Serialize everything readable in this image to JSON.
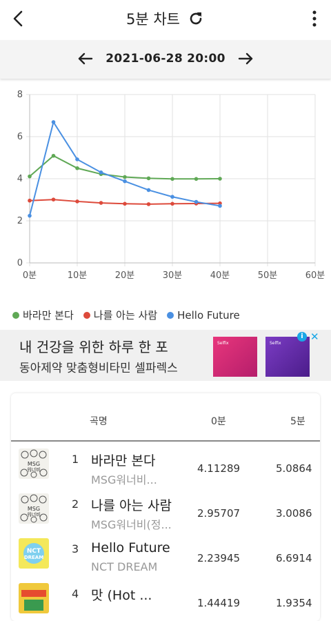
{
  "header": {
    "title": "5분 차트"
  },
  "date_nav": {
    "date": "2021-06-28 20:00"
  },
  "chart_data": {
    "type": "line",
    "x": [
      0,
      5,
      10,
      15,
      20,
      25,
      30,
      35,
      40
    ],
    "x_ticks": [
      "0분",
      "10분",
      "20분",
      "30분",
      "40분",
      "50분",
      "60분"
    ],
    "x_tick_values": [
      0,
      10,
      20,
      30,
      40,
      50,
      60
    ],
    "xlim": [
      0,
      60
    ],
    "ylim": [
      0,
      8
    ],
    "y_ticks": [
      0,
      2,
      4,
      6,
      8
    ],
    "grid": true,
    "legend_position": "bottom",
    "series": [
      {
        "name": "바라만 본다",
        "color": "#5fa855",
        "values": [
          4.11,
          5.09,
          4.5,
          4.22,
          4.08,
          4.02,
          3.99,
          3.99,
          4.0
        ]
      },
      {
        "name": "나를 아는 사람",
        "color": "#dd4a3b",
        "values": [
          2.96,
          3.01,
          2.92,
          2.85,
          2.81,
          2.79,
          2.81,
          2.82,
          2.83
        ]
      },
      {
        "name": "Hello Future",
        "color": "#4a90e2",
        "values": [
          2.24,
          6.69,
          4.92,
          4.3,
          3.88,
          3.46,
          3.14,
          2.9,
          2.71
        ]
      }
    ]
  },
  "ad": {
    "headline": "내 건강을 위한 하루 한 포",
    "subline": "동아제약 맞춤형비타민 셀파렉스",
    "product_label": "Selfix",
    "info_icon": "i",
    "close_icon": "✕"
  },
  "table": {
    "columns": {
      "title": "곡명",
      "min0": "0분",
      "min5": "5분"
    },
    "rows": [
      {
        "rank": "1",
        "title": "바라만 본다",
        "artist": "MSG워너비...",
        "v0": "4.11289",
        "v5": "5.0864",
        "art": "msg"
      },
      {
        "rank": "2",
        "title": "나를 아는 사람",
        "artist": "MSG워너비(정...",
        "v0": "2.95707",
        "v5": "3.0086",
        "art": "msg"
      },
      {
        "rank": "3",
        "title": "Hello Future",
        "artist": "NCT DREAM",
        "v0": "2.23945",
        "v5": "6.6914",
        "art": "nct"
      },
      {
        "rank": "4",
        "title": "맛 (Hot ...",
        "artist": "",
        "v0": "1.44419",
        "v5": "1.9354",
        "art": "hot"
      }
    ]
  }
}
